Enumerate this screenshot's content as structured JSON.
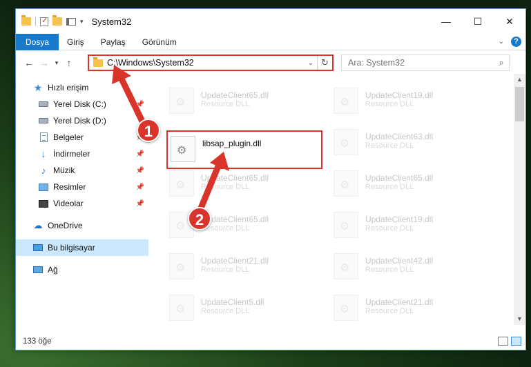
{
  "window": {
    "title": "System32",
    "controls": {
      "minimize": "—",
      "maximize": "☐",
      "close": "✕"
    }
  },
  "ribbon": {
    "tabs": [
      "Dosya",
      "Giriş",
      "Paylaş",
      "Görünüm"
    ],
    "help": "?"
  },
  "navbar": {
    "address": "C:\\Windows\\System32",
    "search_placeholder": "Ara: System32"
  },
  "sidebar": {
    "items": [
      {
        "label": "Hızlı erişim",
        "icon": "star-icon",
        "pinned": false
      },
      {
        "label": "Yerel Disk (C:)",
        "icon": "drive-icon",
        "pinned": true
      },
      {
        "label": "Yerel Disk (D:)",
        "icon": "drive-icon",
        "pinned": false
      },
      {
        "label": "Belgeler",
        "icon": "document-icon",
        "pinned": true
      },
      {
        "label": "İndirmeler",
        "icon": "download-icon",
        "pinned": true
      },
      {
        "label": "Müzik",
        "icon": "music-icon",
        "pinned": true
      },
      {
        "label": "Resimler",
        "icon": "pictures-icon",
        "pinned": true
      },
      {
        "label": "Videolar",
        "icon": "video-icon",
        "pinned": true
      },
      {
        "label": "OneDrive",
        "icon": "cloud-icon",
        "pinned": false
      },
      {
        "label": "Bu bilgisayar",
        "icon": "computer-icon",
        "pinned": false,
        "selected": true
      },
      {
        "label": "Ağ",
        "icon": "network-icon",
        "pinned": false
      }
    ]
  },
  "files": {
    "highlighted": {
      "name": "libsap_plugin.dll"
    },
    "background": [
      {
        "name": "UpdateClient65.dll",
        "desc": "Resource DLL"
      },
      {
        "name": "UpdateClient19.dll",
        "desc": "Resource DLL"
      },
      {
        "name": "UpdateClient63.dll",
        "desc": "Resource DLL"
      },
      {
        "name": "UpdateClient65.dll",
        "desc": "Resource DLL"
      },
      {
        "name": "UpdateClient65.dll",
        "desc": "Resource DLL"
      },
      {
        "name": "UpdateClient65.dll",
        "desc": "Resource DLL"
      },
      {
        "name": "UpdateClient19.dll",
        "desc": "Resource DLL"
      },
      {
        "name": "UpdateClient21.dll",
        "desc": "Resource DLL"
      },
      {
        "name": "UpdateClient42.dll",
        "desc": "Resource DLL"
      },
      {
        "name": "UpdateClient5.dll",
        "desc": "Resource DLL"
      },
      {
        "name": "UpdateClient21.dll",
        "desc": "Resource DLL"
      }
    ]
  },
  "statusbar": {
    "count": "133 öğe"
  },
  "annotations": {
    "badge1": "1",
    "badge2": "2",
    "color": "#d9342b"
  }
}
